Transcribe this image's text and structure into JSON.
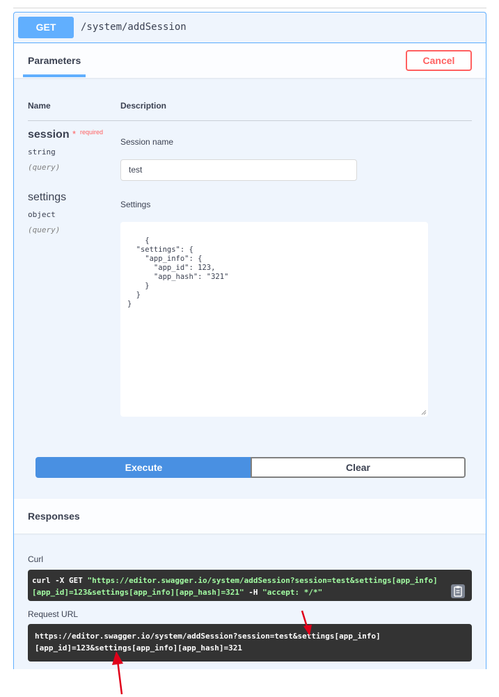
{
  "endpoint": {
    "method": "GET",
    "path": "/system/addSession"
  },
  "parameters_section": {
    "tab_label": "Parameters",
    "cancel_label": "Cancel",
    "col_name": "Name",
    "col_description": "Description",
    "params": [
      {
        "name": "session",
        "required_mark": "*",
        "required_label": "required",
        "type": "string",
        "in": "(query)",
        "description": "Session name",
        "value": "test"
      },
      {
        "name": "settings",
        "type": "object",
        "in": "(query)",
        "description": "Settings",
        "value": "{\n  \"settings\": {\n    \"app_info\": {\n      \"app_id\": 123,\n      \"app_hash\": \"321\"\n    }\n  }\n}"
      }
    ]
  },
  "actions": {
    "execute_label": "Execute",
    "clear_label": "Clear"
  },
  "responses_section": {
    "title": "Responses",
    "curl_label": "Curl",
    "curl_prefix": "curl -X GET ",
    "curl_url": "\"https://editor.swagger.io/system/addSession?session=test&settings[app_info]",
    "curl_url_line2": "[app_id]=123&settings[app_info][app_hash]=321\"",
    "curl_flag": " -H ",
    "curl_header": "\"accept: */*\"",
    "request_url_label": "Request URL",
    "request_url_line1": "https://editor.swagger.io/system/addSession?session=test&settings[app_info]",
    "request_url_line2": "[app_id]=123&settings[app_info][app_hash]=321"
  },
  "colors": {
    "get_accent": "#61affe",
    "execute_blue": "#4990e2",
    "cancel_red": "#ff6060",
    "code_bg": "#333333",
    "annotation_arrow": "#e0001a"
  },
  "icons": [
    "copy-to-clipboard-icon",
    "annotation-arrow-icon"
  ]
}
